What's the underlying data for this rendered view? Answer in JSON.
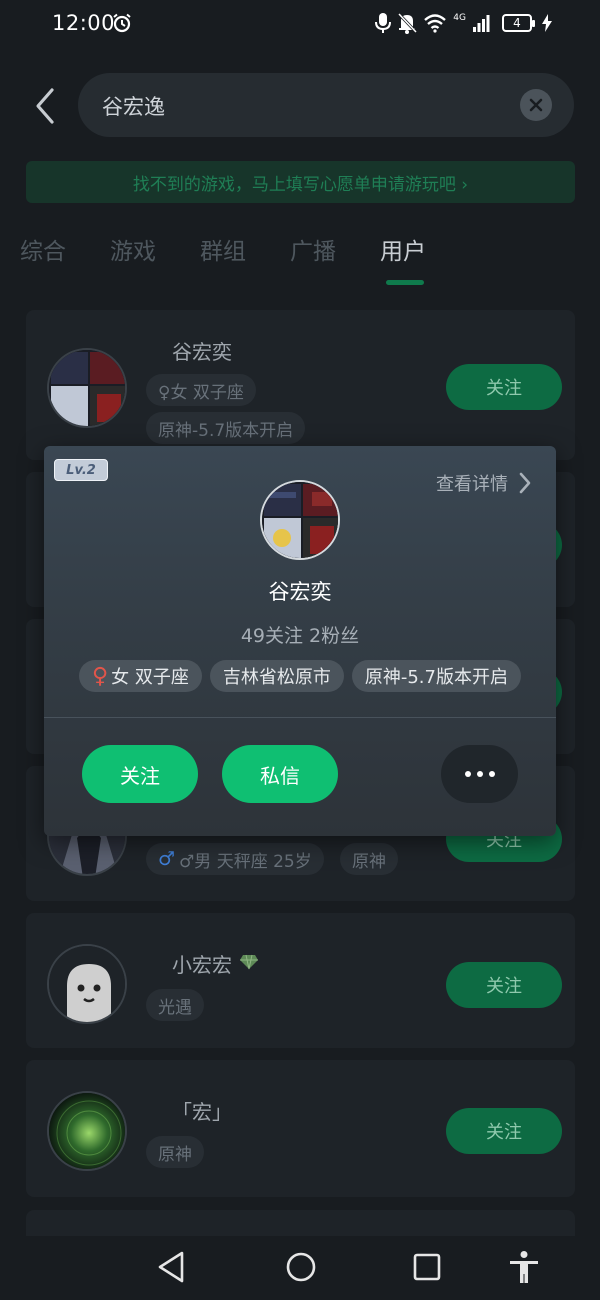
{
  "status_bar": {
    "time": "12:00",
    "signal_label": "4G",
    "battery_level": "4",
    "icons": [
      "alarm-icon",
      "mic-icon",
      "bell-off-icon",
      "wifi-icon",
      "signal-icon",
      "battery-icon",
      "charging-icon"
    ]
  },
  "search": {
    "query": "谷宏逸"
  },
  "banner": {
    "text": "找不到的游戏，马上填写心愿单申请游玩吧 ›"
  },
  "tabs": [
    {
      "label": "综合",
      "active": false
    },
    {
      "label": "游戏",
      "active": false
    },
    {
      "label": "群组",
      "active": false
    },
    {
      "label": "广播",
      "active": false
    },
    {
      "label": "用户",
      "active": true
    }
  ],
  "results": [
    {
      "name": "谷宏奕",
      "chips": [
        "♀女 双子座",
        "原神-5.7版本开启"
      ],
      "follow_label": "关注"
    },
    {
      "name": "",
      "chips": [],
      "follow_label": ""
    },
    {
      "name": "",
      "chips": [],
      "follow_label": ""
    },
    {
      "name": "",
      "chips": [
        "♂男 天秤座 25岁",
        "原神"
      ],
      "follow_label": "关注"
    },
    {
      "name": "小宏宏",
      "chips": [
        "光遇"
      ],
      "follow_label": "关注"
    },
    {
      "name": "「宏」",
      "chips": [
        "原神"
      ],
      "follow_label": "关注"
    }
  ],
  "popup": {
    "level_badge": "Lv.2",
    "detail_link": "查看详情",
    "name": "谷宏奕",
    "stats": "49关注 2粉丝",
    "chips": [
      {
        "symbol": "♀",
        "text": "女 双子座"
      },
      {
        "symbol": "",
        "text": "吉林省松原市"
      },
      {
        "symbol": "",
        "text": "原神-5.7版本开启"
      }
    ],
    "follow_label": "关注",
    "message_label": "私信"
  },
  "colors": {
    "background": "#181c20",
    "accent_green": "#0fbf72",
    "female_symbol": "#e2554a",
    "male_symbol": "#3f7fd8"
  }
}
